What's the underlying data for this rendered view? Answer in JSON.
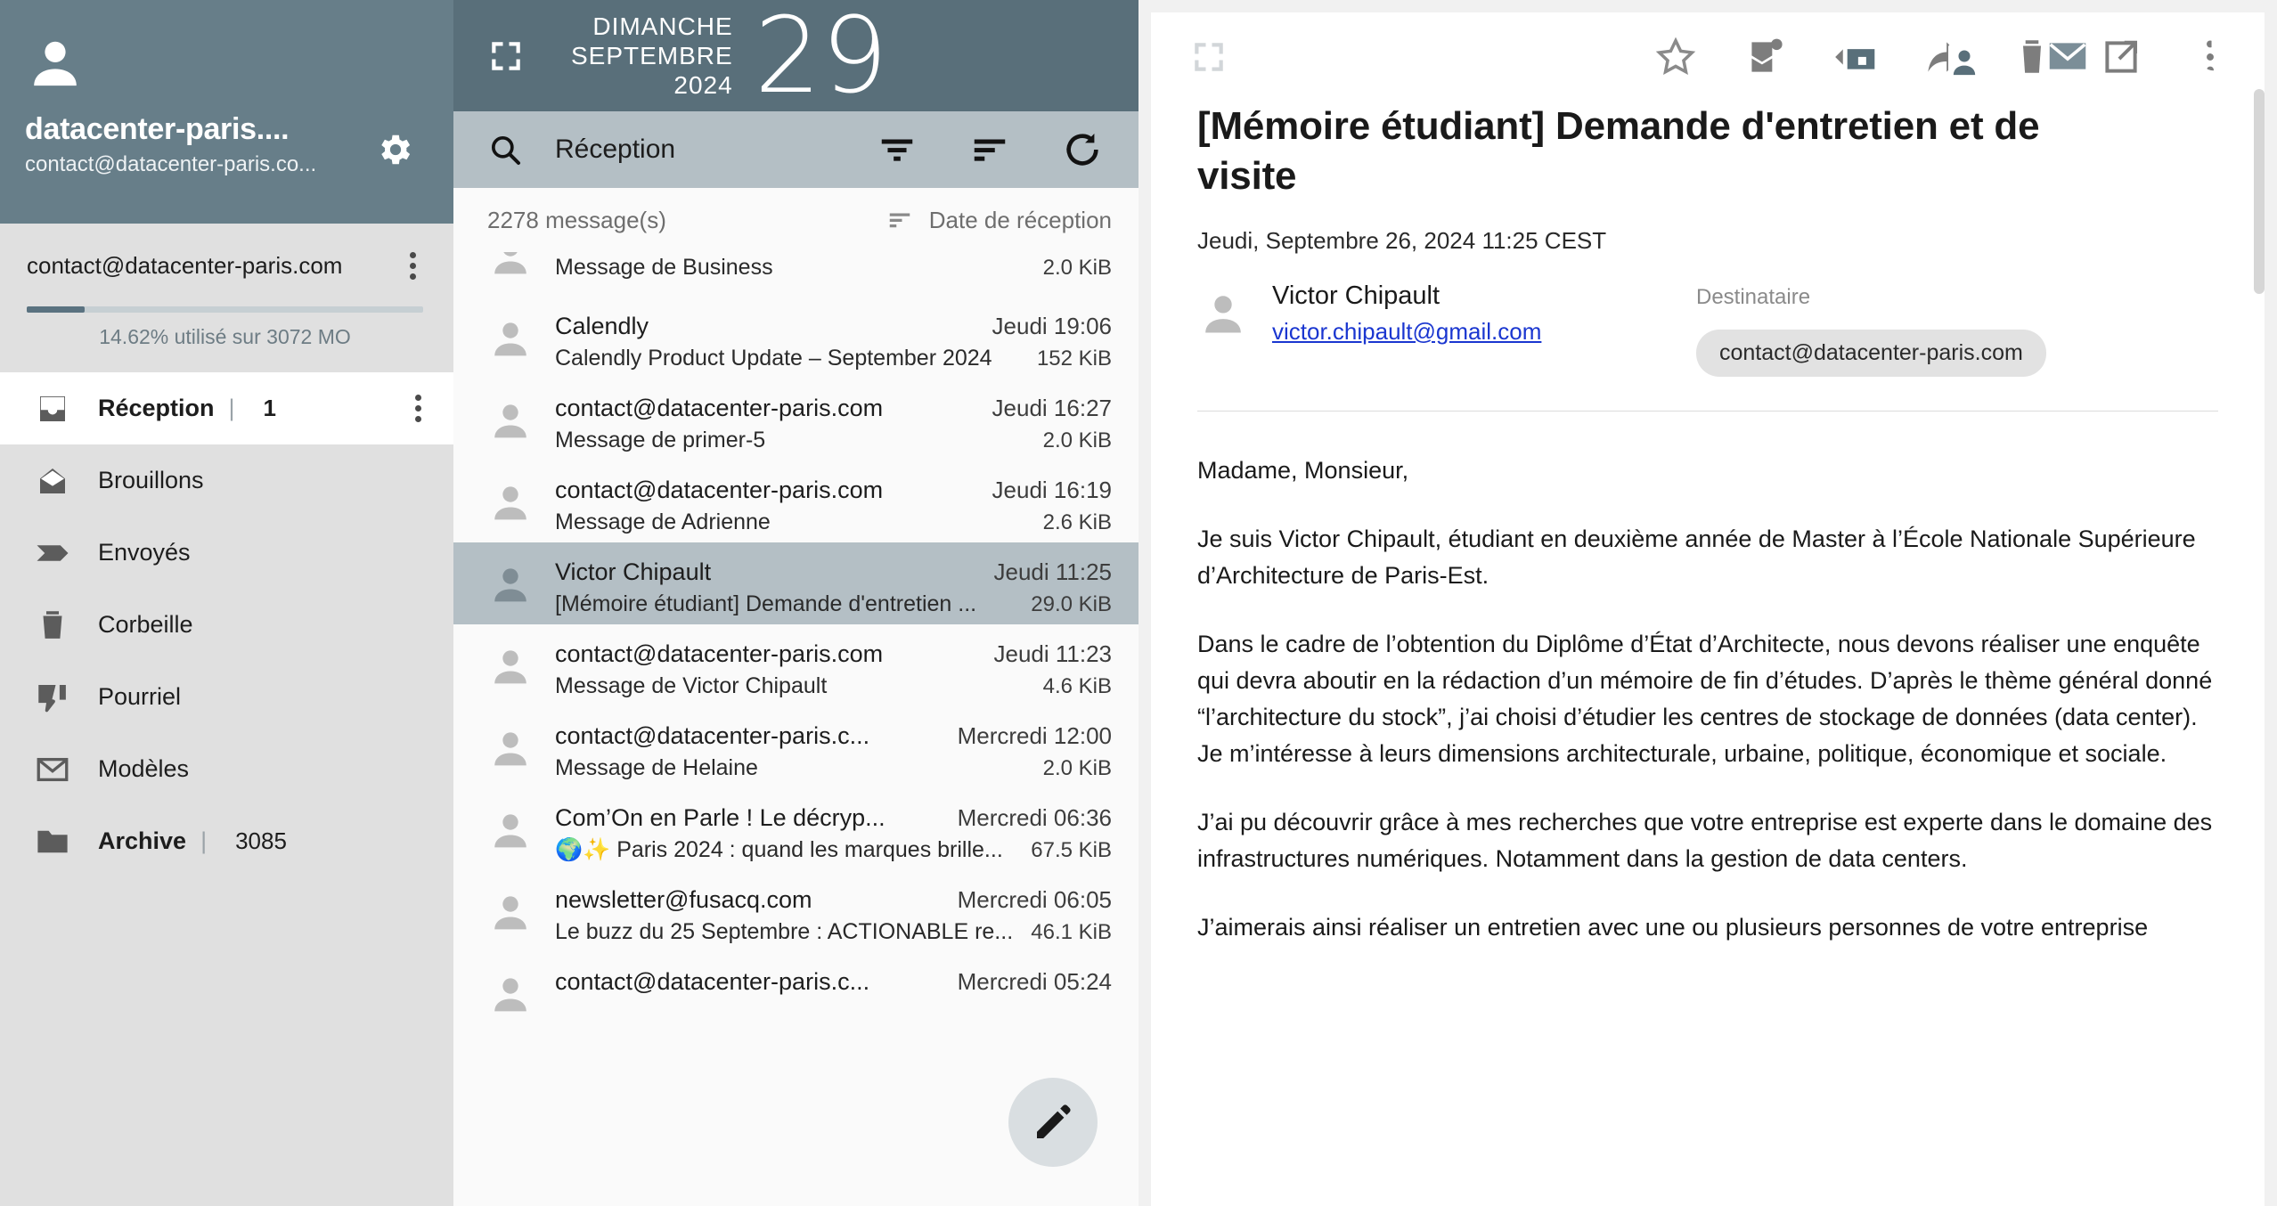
{
  "sidebar": {
    "account": {
      "title": "datacenter-paris....",
      "email": "contact@datacenter-paris.co...",
      "avatar_icon": "person-icon",
      "settings_icon": "gear-icon"
    },
    "quota": {
      "email": "contact@datacenter-paris.com",
      "usage_text": "14.62% utilisé sur 3072 MO",
      "percent": 14.62,
      "menu_icon": "kebab-menu-icon"
    },
    "folders": [
      {
        "label": "Réception",
        "count": "1",
        "icon": "inbox-icon",
        "active": true,
        "has_menu": true
      },
      {
        "label": "Brouillons",
        "count": "",
        "icon": "draft-envelope-icon",
        "active": false,
        "has_menu": false
      },
      {
        "label": "Envoyés",
        "count": "",
        "icon": "send-arrow-icon",
        "active": false,
        "has_menu": false
      },
      {
        "label": "Corbeille",
        "count": "",
        "icon": "trash-icon",
        "active": false,
        "has_menu": false
      },
      {
        "label": "Pourriel",
        "count": "",
        "icon": "thumbs-down-icon",
        "active": false,
        "has_menu": false
      },
      {
        "label": "Modèles",
        "count": "",
        "icon": "envelope-outline-icon",
        "active": false,
        "has_menu": false
      },
      {
        "label": "Archive",
        "count": "3085",
        "icon": "folder-icon",
        "active": false,
        "has_menu": false
      }
    ]
  },
  "topbar": {
    "expand_icon": "fullscreen-icon",
    "weekday": "DIMANCHE",
    "month": "SEPTEMBRE",
    "year": "2024",
    "day": "29",
    "apps": [
      {
        "name": "calendar-icon",
        "active": false
      },
      {
        "name": "contacts-icon",
        "active": false
      },
      {
        "name": "mail-icon",
        "active": true
      },
      {
        "name": "power-icon",
        "active": false
      }
    ]
  },
  "list": {
    "search": {
      "icon": "search-icon",
      "label": "Réception",
      "placeholder": "Réception"
    },
    "toolbar": [
      {
        "name": "filter-icon"
      },
      {
        "name": "sort-icon"
      },
      {
        "name": "refresh-icon"
      }
    ],
    "count_text": "2278 message(s)",
    "sort_label": "Date de réception",
    "sort_icon": "sort-icon",
    "compose_icon": "pencil-icon",
    "messages": [
      {
        "from": "",
        "when": "",
        "subject": "Message de Business",
        "size": "2.0 KiB",
        "selected": false,
        "partial": true
      },
      {
        "from": "Calendly",
        "when": "Jeudi 19:06",
        "subject": "Calendly Product Update – September 2024",
        "size": "152 KiB",
        "selected": false,
        "partial": false
      },
      {
        "from": "contact@datacenter-paris.com",
        "when": "Jeudi 16:27",
        "subject": "Message de primer-5",
        "size": "2.0 KiB",
        "selected": false,
        "partial": false
      },
      {
        "from": "contact@datacenter-paris.com",
        "when": "Jeudi 16:19",
        "subject": "Message de Adrienne",
        "size": "2.6 KiB",
        "selected": false,
        "partial": false
      },
      {
        "from": "Victor Chipault",
        "when": "Jeudi 11:25",
        "subject": "[Mémoire étudiant] Demande d'entretien ...",
        "size": "29.0 KiB",
        "selected": true,
        "partial": false
      },
      {
        "from": "contact@datacenter-paris.com",
        "when": "Jeudi 11:23",
        "subject": "Message de Victor Chipault",
        "size": "4.6 KiB",
        "selected": false,
        "partial": false
      },
      {
        "from": "contact@datacenter-paris.c...",
        "when": "Mercredi 12:00",
        "subject": "Message de Helaine",
        "size": "2.0 KiB",
        "selected": false,
        "partial": false
      },
      {
        "from": "Com’On en Parle ! Le décryp...",
        "when": "Mercredi 06:36",
        "subject": "🌍✨ Paris 2024 : quand les marques brille...",
        "size": "67.5 KiB",
        "selected": false,
        "partial": false
      },
      {
        "from": "newsletter@fusacq.com",
        "when": "Mercredi 06:05",
        "subject": "Le buzz du 25 Septembre : ACTIONABLE re...",
        "size": "46.1 KiB",
        "selected": false,
        "partial": false
      },
      {
        "from": "contact@datacenter-paris.c...",
        "when": "Mercredi 05:24",
        "subject": "",
        "size": "",
        "selected": false,
        "partial": true
      }
    ]
  },
  "reader": {
    "expand_icon": "fullscreen-icon",
    "toolbar": [
      {
        "name": "star-icon"
      },
      {
        "name": "mark-unread-icon"
      },
      {
        "name": "reply-icon"
      },
      {
        "name": "forward-icon"
      },
      {
        "name": "delete-icon"
      },
      {
        "name": "open-external-icon"
      },
      {
        "name": "more-options-icon"
      }
    ],
    "subject": "[Mémoire étudiant] Demande d'entretien et de visite",
    "date": "Jeudi, Septembre 26, 2024 11:25 CEST",
    "sender_name": "Victor Chipault",
    "sender_email": "victor.chipault@gmail.com",
    "recipient_label": "Destinataire",
    "recipient_chip": "contact@datacenter-paris.com",
    "body": [
      "Madame, Monsieur,",
      "Je suis Victor Chipault, étudiant en deuxième année de Master à l’École Nationale Supérieure d’Architecture de Paris-Est.",
      "Dans le cadre de l’obtention du Diplôme d’État d’Architecte, nous devons réaliser une enquête qui devra aboutir en la rédaction d’un mémoire de fin d’études. D’après le thème général donné “l’architecture du stock”, j’ai choisi d’étudier les centres de stockage de données (data center). Je m’intéresse à leurs dimensions architecturale, urbaine, politique, économique et sociale.",
      "J’ai pu découvrir grâce à mes recherches que votre entreprise est experte dans le domaine des infrastructures numériques. Notamment dans la gestion de data centers.",
      "J’aimerais ainsi réaliser un  entretien avec une ou plusieurs personnes de votre entreprise"
    ]
  },
  "colors": {
    "header_blue": "#677e89",
    "topbar_blue": "#596f7a",
    "search_gray": "#b4bfc5",
    "sidebar_gray": "#e0e0e0",
    "link_blue": "#1a36d0"
  }
}
